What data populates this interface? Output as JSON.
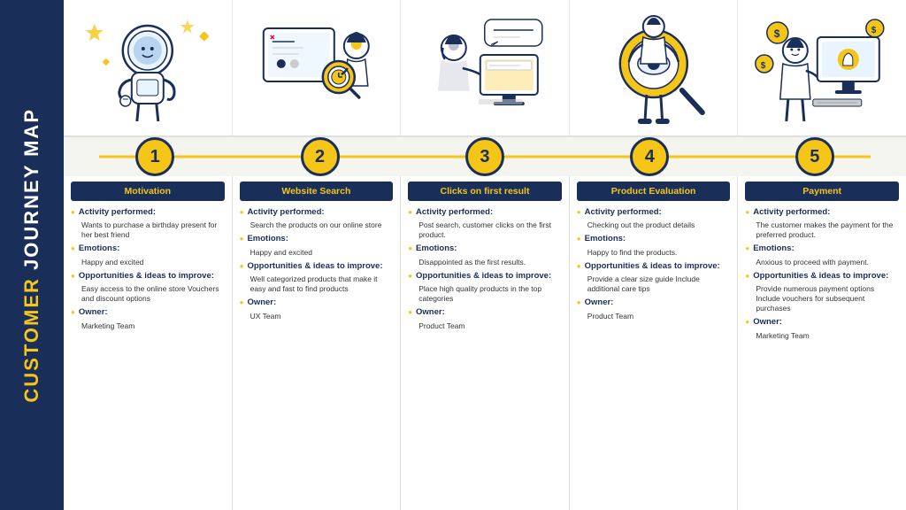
{
  "sidebar": {
    "line1": "CUSTOMER",
    "line2": " JOURNEY MAP"
  },
  "steps": [
    {
      "number": "1",
      "header": "Motivation",
      "activity_label": "Activity performed:",
      "activity_text": "Wants to purchase a birthday present for her best friend",
      "emotions_label": "Emotions:",
      "emotions_text": "Happy and excited",
      "opportunities_label": "Opportunities & ideas to improve:",
      "opportunities_text": "Easy access to the online store\nVouchers and discount options",
      "owner_label": "Owner:",
      "owner_text": "Marketing Team"
    },
    {
      "number": "2",
      "header": "Website Search",
      "activity_label": "Activity performed:",
      "activity_text": "Search the products on our online store",
      "emotions_label": "Emotions:",
      "emotions_text": "Happy and excited",
      "opportunities_label": "Opportunities & ideas to improve:",
      "opportunities_text": "Well categorized products that make it easy and fast to find products",
      "owner_label": "Owner:",
      "owner_text": "UX Team"
    },
    {
      "number": "3",
      "header": "Clicks on first result",
      "activity_label": "Activity performed:",
      "activity_text": "Post search, customer clicks on the first product.",
      "emotions_label": "Emotions:",
      "emotions_text": "Disappointed as the first results.",
      "opportunities_label": "Opportunities & ideas to improve:",
      "opportunities_text": "Place high quality products in the top categories",
      "owner_label": "Owner:",
      "owner_text": "Product Team"
    },
    {
      "number": "4",
      "header": "Product Evaluation",
      "activity_label": "Activity performed:",
      "activity_text": "Checking out the product details",
      "emotions_label": "Emotions:",
      "emotions_text": "Happy to find the products.",
      "opportunities_label": "Opportunities & ideas to improve:",
      "opportunities_text": "Provide a clear size guide\nInclude additional care tips",
      "owner_label": "Owner:",
      "owner_text": "Product Team"
    },
    {
      "number": "5",
      "header": "Payment",
      "activity_label": "Activity performed:",
      "activity_text": "The customer makes the payment for the preferred product.",
      "emotions_label": "Emotions:",
      "emotions_text": "Anxious to proceed with payment.",
      "opportunities_label": "Opportunities & ideas to improve:",
      "opportunities_text": "Provide numerous payment options\nInclude vouchers for subsequent purchases",
      "owner_label": "Owner:",
      "owner_text": "Marketing Team"
    }
  ]
}
